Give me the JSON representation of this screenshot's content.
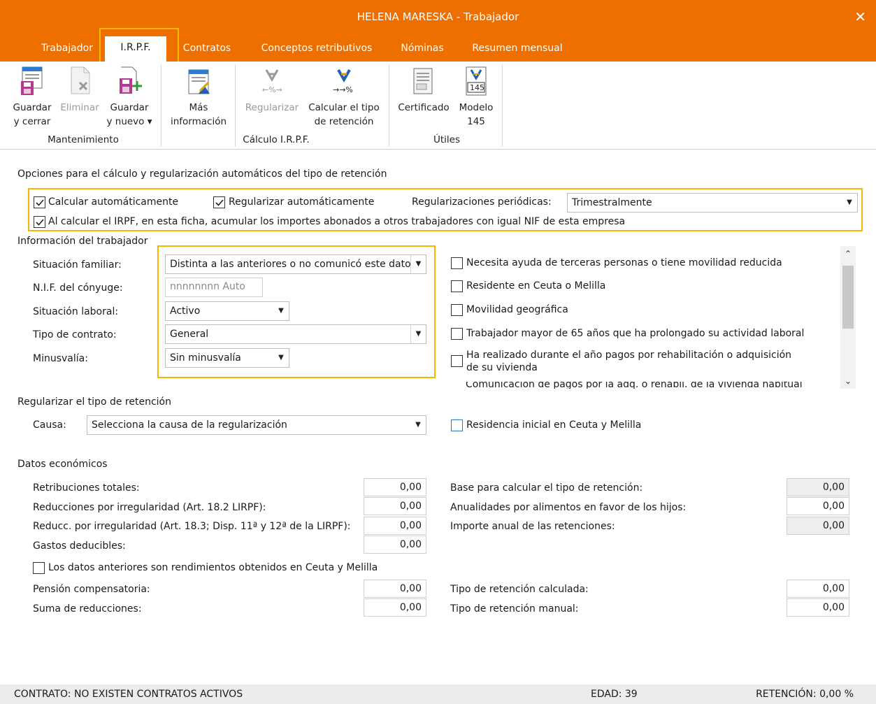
{
  "window": {
    "title": "HELENA MARESKA - Trabajador"
  },
  "tabs": [
    {
      "label": "Trabajador"
    },
    {
      "label": "I.R.P.F."
    },
    {
      "label": "Contratos"
    },
    {
      "label": "Conceptos retributivos"
    },
    {
      "label": "Nóminas"
    },
    {
      "label": "Resumen mensual"
    }
  ],
  "ribbon": {
    "save_close": {
      "line1": "Guardar",
      "line2": "y cerrar"
    },
    "delete": {
      "line1": "Eliminar"
    },
    "save_new": {
      "line1": "Guardar",
      "line2": "y nuevo ▾"
    },
    "more_info": {
      "line1": "Más",
      "line2": "información"
    },
    "regularize": {
      "line1": "Regularizar"
    },
    "calc_rate": {
      "line1": "Calcular el tipo",
      "line2": "de retención"
    },
    "certificate": {
      "line1": "Certificado"
    },
    "model145": {
      "line1": "Modelo",
      "line2": "145",
      "icon_text": "145"
    },
    "groups": {
      "maintenance": "Mantenimiento",
      "irpf_calc": "Cálculo I.R.P.F.",
      "tools": "Útiles"
    }
  },
  "auto_options": {
    "title": "Opciones para el cálculo y regularización automáticos del tipo de retención",
    "calc_auto": {
      "label": "Calcular automáticamente",
      "checked": true
    },
    "regularize_auto": {
      "label": "Regularizar automáticamente",
      "checked": true
    },
    "periodic_label": "Regularizaciones periódicas:",
    "periodic_value": "Trimestralmente",
    "accumulate": {
      "label": "Al calcular el IRPF, en esta ficha, acumular los importes abonados a otros trabajadores con igual NIF de esta empresa",
      "checked": true
    }
  },
  "worker_info": {
    "title": "Información del trabajador",
    "family_label": "Situación familiar:",
    "family_value": "Distinta a las anteriores o no comunicó este dato",
    "spouse_nif_label": "N.I.F. del cónyuge:",
    "spouse_nif_placeholder": "nnnnnnnn Auto",
    "employment_label": "Situación laboral:",
    "employment_value": "Activo",
    "contract_label": "Tipo de contrato:",
    "contract_value": "General",
    "disability_label": "Minusvalía:",
    "disability_value": "Sin minusvalía",
    "checks": [
      {
        "label": "Necesita ayuda de terceras personas o tiene movilidad reducida",
        "checked": false
      },
      {
        "label": "Residente en Ceuta o Melilla",
        "checked": false
      },
      {
        "label": "Movilidad geográfica",
        "checked": false
      },
      {
        "label": "Trabajador mayor de 65 años que ha prolongado su actividad laboral",
        "checked": false
      },
      {
        "label_line1": "Ha realizado durante el año pagos por rehabilitación o adquisición",
        "label_line2": "de su vivienda",
        "checked": false
      }
    ],
    "partial_text": "Comunicación de pagos por la adq. o rehabil. de la vivienda habitual"
  },
  "regularize": {
    "title": "Regularizar el tipo de retención",
    "cause_label": "Causa:",
    "cause_value": "Selecciona la causa de la regularización",
    "ceuta_initial": {
      "label": "Residencia inicial en Ceuta y Melilla",
      "checked": false
    }
  },
  "economic": {
    "title": "Datos económicos",
    "left": [
      {
        "label": "Retribuciones totales:",
        "value": "0,00"
      },
      {
        "label": "Reducciones por irregularidad (Art. 18.2 LIRPF):",
        "value": "0,00"
      },
      {
        "label": "Reducc. por irregularidad (Art. 18.3; Disp. 11ª y 12ª de la LIRPF):",
        "value": "0,00"
      },
      {
        "label": "Gastos deducibles:",
        "value": "0,00"
      }
    ],
    "right": [
      {
        "label": "Base para calcular el tipo de retención:",
        "value": "0,00"
      },
      {
        "label": "Anualidades por alimentos en favor de los hijos:",
        "value": "0,00"
      },
      {
        "label": "Importe anual de las retenciones:",
        "value": "0,00"
      }
    ],
    "ceuta_check": {
      "label": "Los datos anteriores son rendimientos obtenidos en Ceuta y Melilla",
      "checked": false
    },
    "pension_label": "Pensión compensatoria:",
    "pension_value": "0,00",
    "sum_label": "Suma de reducciones:",
    "sum_value": "0,00",
    "rate_calc_label": "Tipo de retención calculada:",
    "rate_calc_value": "0,00",
    "rate_manual_label": "Tipo de retención manual:",
    "rate_manual_value": "0,00"
  },
  "status": {
    "contract": "CONTRATO: NO EXISTEN CONTRATOS ACTIVOS",
    "age": "EDAD: 39",
    "retention": "RETENCIÓN: 0,00 %"
  },
  "colors": {
    "accent": "#ec6f00",
    "highlight": "#f5b800",
    "checkbox_blue": "#2b79c9"
  }
}
